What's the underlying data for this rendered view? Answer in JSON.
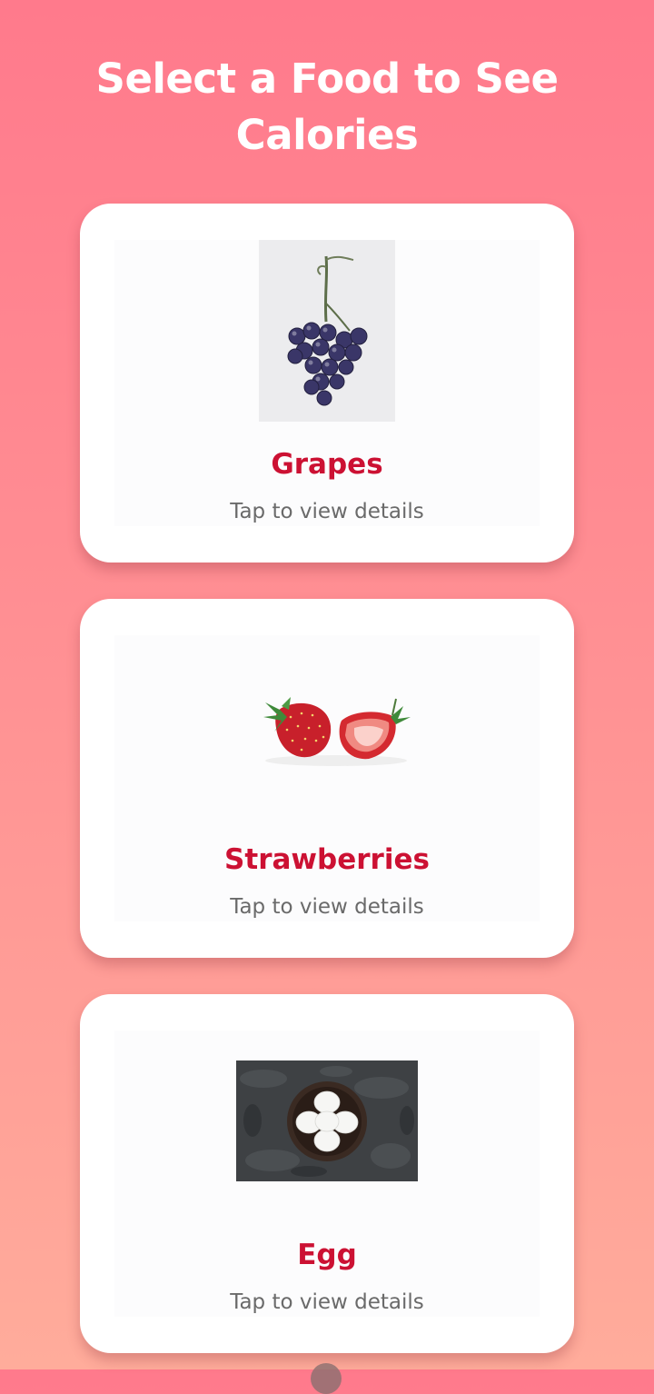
{
  "header": {
    "title": "Select a Food to See Calories"
  },
  "foods": [
    {
      "name": "Grapes",
      "subtitle": "Tap to view details",
      "image": "grapes-photo"
    },
    {
      "name": "Strawberries",
      "subtitle": "Tap to view details",
      "image": "strawberries-photo"
    },
    {
      "name": "Egg",
      "subtitle": "Tap to view details",
      "image": "eggs-in-bowl-photo"
    }
  ],
  "colors": {
    "background_top": "#ff7a8c",
    "background_bottom": "#ffac9b",
    "card": "#ffffff",
    "title_text": "#ffffff",
    "food_name": "#cc1133",
    "subtitle_text": "#6a6a6a"
  }
}
